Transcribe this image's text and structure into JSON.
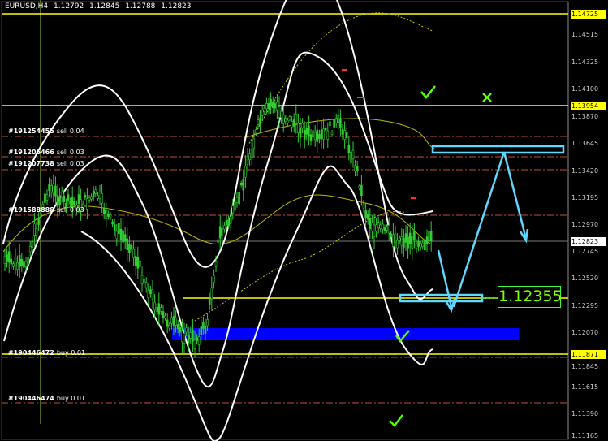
{
  "header": {
    "symbol": "EURUSD,H4",
    "open": "1.12792",
    "high": "1.12845",
    "low": "1.12788",
    "close": "1.12823"
  },
  "price_axis": {
    "ticks": [
      "1.14515",
      "1.14325",
      "1.14100",
      "1.13870",
      "1.13645",
      "1.13420",
      "1.13195",
      "1.12970",
      "1.12745",
      "1.12520",
      "1.12295",
      "1.12070",
      "1.11845",
      "1.11615",
      "1.11390",
      "1.11165"
    ],
    "highlight_yellow": [
      "1.14725",
      "1.13954",
      "1.11871"
    ],
    "current_price": "1.12823"
  },
  "orders": [
    {
      "id": "#191254455",
      "info": "sell 0.04"
    },
    {
      "id": "#191206466",
      "info": "sell 0.03"
    },
    {
      "id": "#191207738",
      "info": "sell 0.03"
    },
    {
      "id": "#191588888",
      "info": "sell 0.03"
    },
    {
      "id": "#190446472",
      "info": "buy 0.01"
    },
    {
      "id": "#190446474",
      "info": "buy 0.01"
    }
  ],
  "annotation": {
    "target_price": "1.12355"
  },
  "colors": {
    "background": "#000000",
    "key_level": "#ffff00",
    "order_line": "#c05030",
    "bands": "#ffffff",
    "demand_zone": "#0000ff",
    "projection": "#5fd8ff",
    "check_mark": "#55ff00",
    "candle": "#32cd32"
  }
}
